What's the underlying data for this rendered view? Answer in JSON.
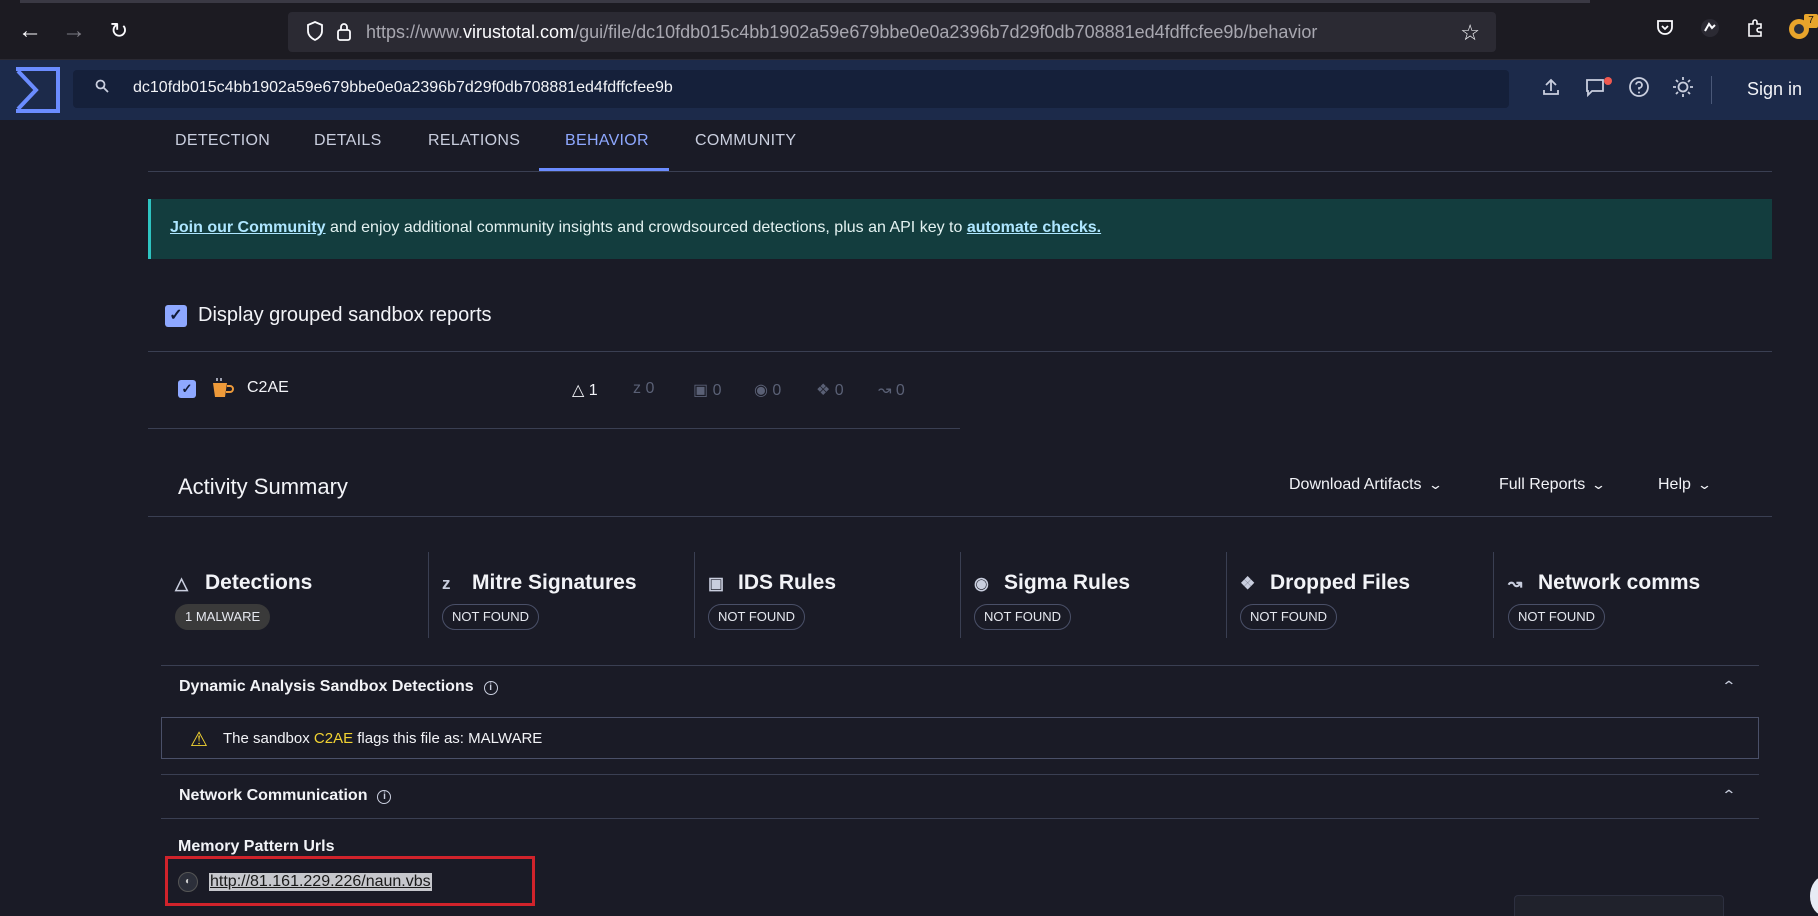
{
  "browser": {
    "url_prefix": "https://www.",
    "url_domain": "virustotal.com",
    "url_path": "/gui/file/dc10fdb015c4bb1902a59e679bbe0e0a2396b7d29f0db708881ed4fdffcfee9b/behavior",
    "extension_badge": "7",
    "icons": [
      "back-icon",
      "forward-icon",
      "reload-icon",
      "shield-icon",
      "lock-icon",
      "star-icon",
      "pocket-icon",
      "extension-icon",
      "puzzle-icon",
      "menu-icon"
    ]
  },
  "header": {
    "search_value": "dc10fdb015c4bb1902a59e679bbe0e0a2396b7d29f0db708881ed4fdffcfee9b",
    "sign_in": "Sign in",
    "icons": [
      "upload-icon",
      "chat-icon",
      "help-icon",
      "theme-icon"
    ]
  },
  "tabs": [
    {
      "label": "DETECTION",
      "active": false
    },
    {
      "label": "DETAILS",
      "active": false
    },
    {
      "label": "RELATIONS",
      "active": false
    },
    {
      "label": "BEHAVIOR",
      "active": true
    },
    {
      "label": "COMMUNITY",
      "active": false
    }
  ],
  "banner": {
    "link1": "Join our Community",
    "middle": " and enjoy additional community insights and crowdsourced detections, plus an API key to ",
    "link2": "automate checks."
  },
  "grouped": {
    "label": "Display grouped sandbox reports",
    "checked": true
  },
  "sandbox": {
    "name": "C2AE",
    "counts": [
      "1",
      "0",
      "0",
      "0",
      "0",
      "0"
    ]
  },
  "activity": {
    "title": "Activity Summary",
    "dropdowns": [
      "Download Artifacts",
      "Full Reports",
      "Help"
    ],
    "cards": [
      {
        "title": "Detections",
        "badge": "1 MALWARE",
        "icon": "warning-icon"
      },
      {
        "title": "Mitre Signatures",
        "badge": "NOT FOUND",
        "icon": "mitre-icon"
      },
      {
        "title": "IDS Rules",
        "badge": "NOT FOUND",
        "icon": "ids-icon"
      },
      {
        "title": "Sigma Rules",
        "badge": "NOT FOUND",
        "icon": "sigma-icon"
      },
      {
        "title": "Dropped Files",
        "badge": "NOT FOUND",
        "icon": "dropped-file-icon"
      },
      {
        "title": "Network comms",
        "badge": "NOT FOUND",
        "icon": "network-icon"
      }
    ]
  },
  "dynamic": {
    "title": "Dynamic Analysis Sandbox Detections",
    "text_before": "The sandbox ",
    "sandbox": "C2AE",
    "text_after": " flags this file as: MALWARE"
  },
  "network": {
    "title": "Network Communication",
    "subtitle": "Memory Pattern Urls",
    "url": "http://81.161.229.226/naun.vbs"
  },
  "colors": {
    "accent": "#8ea8ff",
    "warning": "#f1d232",
    "banner_bg": "#133d3e",
    "highlight_border": "#d0232b"
  }
}
